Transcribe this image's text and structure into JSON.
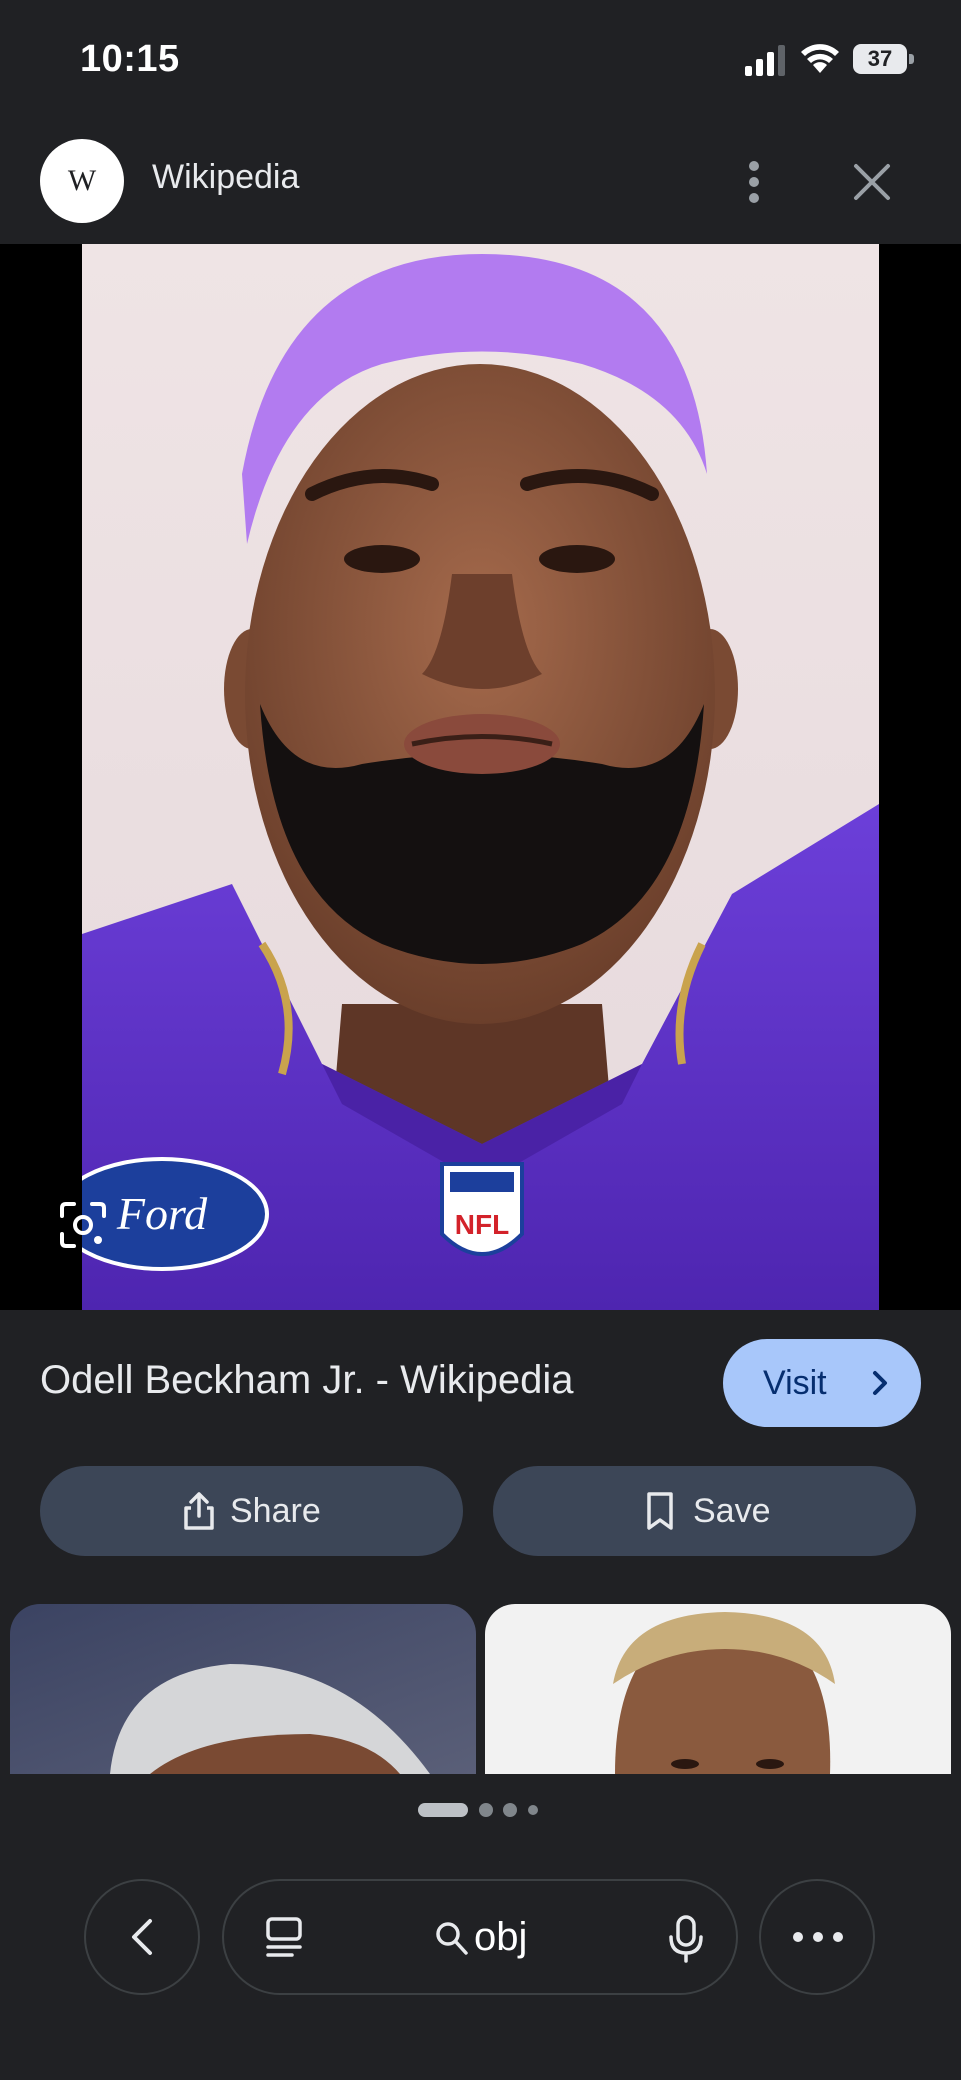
{
  "status_bar": {
    "time": "10:15",
    "battery": "37"
  },
  "header": {
    "logo_letter": "W",
    "site_name": "Wikipedia"
  },
  "image_viewer": {
    "jersey_sponsor_text": "Ford",
    "jersey_badge_text": "NFL"
  },
  "result": {
    "title": "Odell Beckham Jr. - Wikipedia",
    "visit_label": "Visit"
  },
  "actions": {
    "share_label": "Share",
    "save_label": "Save"
  },
  "pagination": {
    "dots": 4,
    "active_index": 0
  },
  "bottom_bar": {
    "search_query": "obj"
  },
  "icons": [
    "signal-icon",
    "wifi-icon",
    "battery-icon",
    "more-vertical-icon",
    "close-icon",
    "lens-icon",
    "chevron-right-icon",
    "share-icon",
    "bookmark-icon",
    "back-icon",
    "tabs-icon",
    "search-icon",
    "mic-icon",
    "more-horizontal-icon"
  ],
  "colors": {
    "background": "#202124",
    "visit_button": "#a8c7fa",
    "pill_button": "#3c4657",
    "jersey_purple": "#5b2fc4",
    "hair_purple": "#b279f0"
  }
}
